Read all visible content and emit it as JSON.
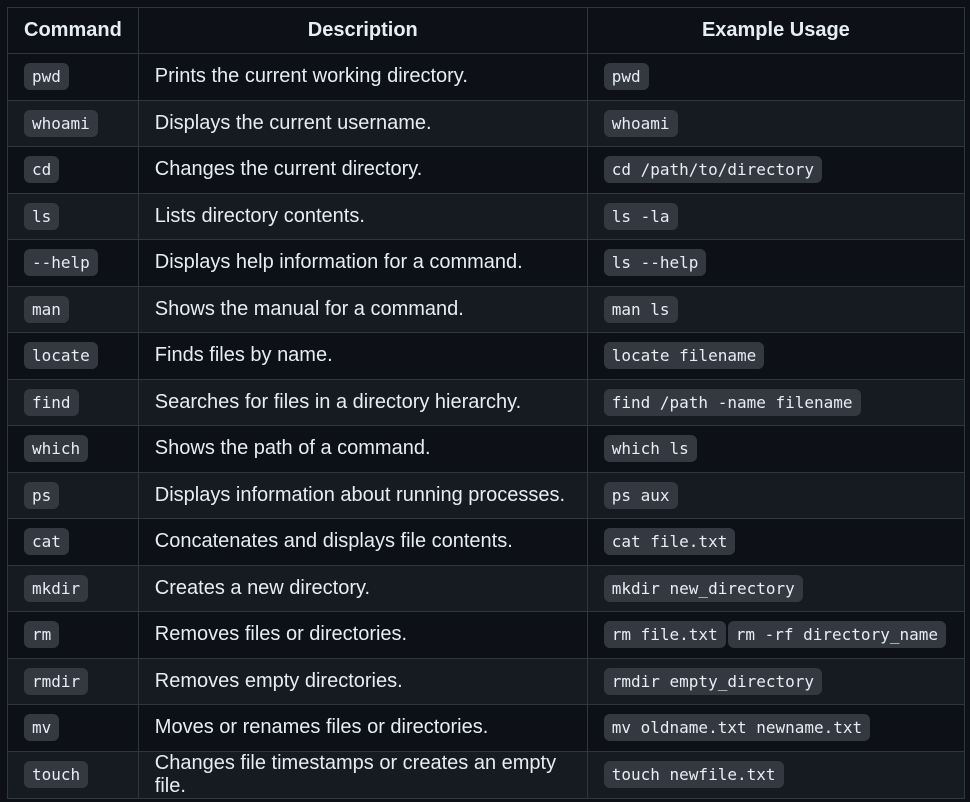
{
  "headers": [
    "Command",
    "Description",
    "Example Usage"
  ],
  "rows": [
    {
      "command": "pwd",
      "description": "Prints the current working directory.",
      "examples": [
        "pwd"
      ]
    },
    {
      "command": "whoami",
      "description": "Displays the current username.",
      "examples": [
        "whoami"
      ]
    },
    {
      "command": "cd",
      "description": "Changes the current directory.",
      "examples": [
        "cd /path/to/directory"
      ]
    },
    {
      "command": "ls",
      "description": "Lists directory contents.",
      "examples": [
        "ls -la"
      ]
    },
    {
      "command": "--help",
      "description": "Displays help information for a command.",
      "examples": [
        "ls --help"
      ]
    },
    {
      "command": "man",
      "description": "Shows the manual for a command.",
      "examples": [
        "man ls"
      ]
    },
    {
      "command": "locate",
      "description": "Finds files by name.",
      "examples": [
        "locate filename"
      ]
    },
    {
      "command": "find",
      "description": "Searches for files in a directory hierarchy.",
      "examples": [
        "find /path -name filename"
      ]
    },
    {
      "command": "which",
      "description": "Shows the path of a command.",
      "examples": [
        "which ls"
      ]
    },
    {
      "command": "ps",
      "description": "Displays information about running processes.",
      "examples": [
        "ps aux"
      ]
    },
    {
      "command": "cat",
      "description": "Concatenates and displays file contents.",
      "examples": [
        "cat file.txt"
      ]
    },
    {
      "command": "mkdir",
      "description": "Creates a new directory.",
      "examples": [
        "mkdir new_directory"
      ]
    },
    {
      "command": "rm",
      "description": "Removes files or directories.",
      "examples": [
        "rm file.txt",
        "rm -rf directory_name"
      ]
    },
    {
      "command": "rmdir",
      "description": "Removes empty directories.",
      "examples": [
        "rmdir empty_directory"
      ]
    },
    {
      "command": "mv",
      "description": "Moves or renames files or directories.",
      "examples": [
        "mv oldname.txt newname.txt"
      ]
    },
    {
      "command": "touch",
      "description": "Changes file timestamps or creates an empty file.",
      "examples": [
        "touch newfile.txt"
      ]
    }
  ]
}
